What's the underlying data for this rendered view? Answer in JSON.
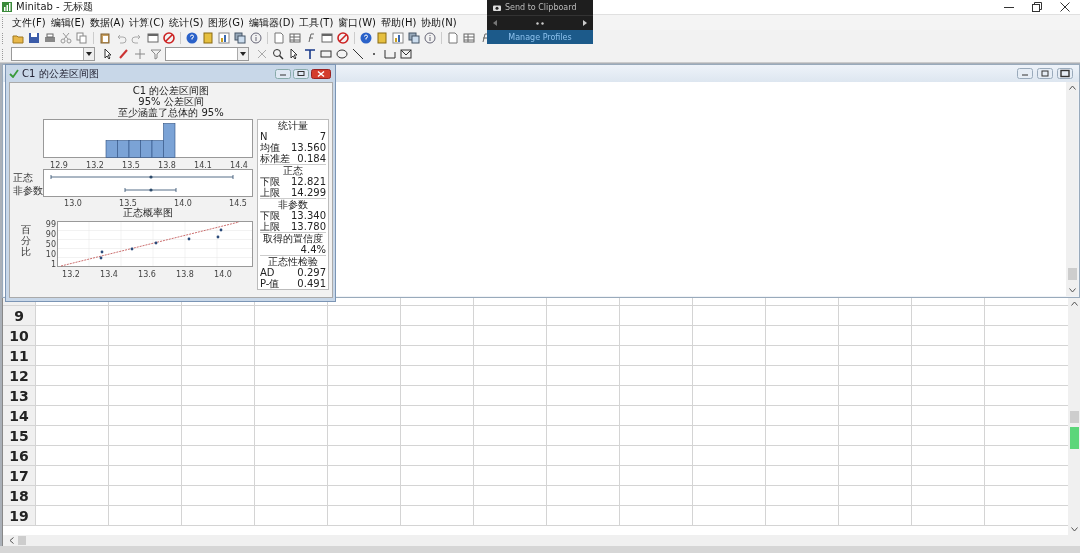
{
  "window": {
    "title": "Minitab - 无标题"
  },
  "menu": [
    "文件(F)",
    "编辑(E)",
    "数据(A)",
    "计算(C)",
    "统计(S)",
    "图形(G)",
    "编辑器(D)",
    "工具(T)",
    "窗口(W)",
    "帮助(H)",
    "协助(N)"
  ],
  "popup": {
    "title": "Send to Clipboard",
    "link": "Manage Profiles"
  },
  "graph_window": {
    "title": "C1 的公差区间图",
    "heading": [
      "C1 的公差区间图",
      "95% 公差区间",
      "至少涵盖了总体的 95%"
    ],
    "histogram": {
      "xticks": [
        "12.9",
        "13.2",
        "13.5",
        "13.8",
        "14.1",
        "14.4"
      ]
    },
    "intervals": {
      "rows": [
        {
          "label": "正态"
        },
        {
          "label": "非参数"
        }
      ],
      "xticks": [
        "13.0",
        "13.5",
        "14.0",
        "14.5"
      ]
    },
    "probability_plot": {
      "title": "正态概率图",
      "ylabel": "百分比",
      "yticks": [
        "99",
        "90",
        "50",
        "10",
        "1"
      ],
      "xticks": [
        "13.2",
        "13.4",
        "13.6",
        "13.8",
        "14.0"
      ]
    },
    "stats": [
      {
        "kind": "header",
        "text": "统计量"
      },
      {
        "kind": "row",
        "label": "N",
        "value": "7"
      },
      {
        "kind": "row",
        "label": "均值",
        "value": "13.560"
      },
      {
        "kind": "row",
        "label": "标准差",
        "value": "0.184"
      },
      {
        "kind": "header",
        "text": "正态"
      },
      {
        "kind": "row",
        "label": "下限",
        "value": "12.821"
      },
      {
        "kind": "row",
        "label": "上限",
        "value": "14.299"
      },
      {
        "kind": "header",
        "text": "非参数"
      },
      {
        "kind": "row",
        "label": "下限",
        "value": "13.340"
      },
      {
        "kind": "row",
        "label": "上限",
        "value": "13.780"
      },
      {
        "kind": "header",
        "text": "取得的置信度"
      },
      {
        "kind": "value",
        "text": "4.4%"
      },
      {
        "kind": "header",
        "text": "正态性检验"
      },
      {
        "kind": "row",
        "label": "AD",
        "value": "0.297"
      },
      {
        "kind": "row",
        "label": "P-值",
        "value": "0.491"
      }
    ]
  },
  "worksheet": {
    "rows": [
      "9",
      "10",
      "11",
      "12",
      "13",
      "14",
      "15",
      "16",
      "17",
      "18",
      "19"
    ]
  }
}
